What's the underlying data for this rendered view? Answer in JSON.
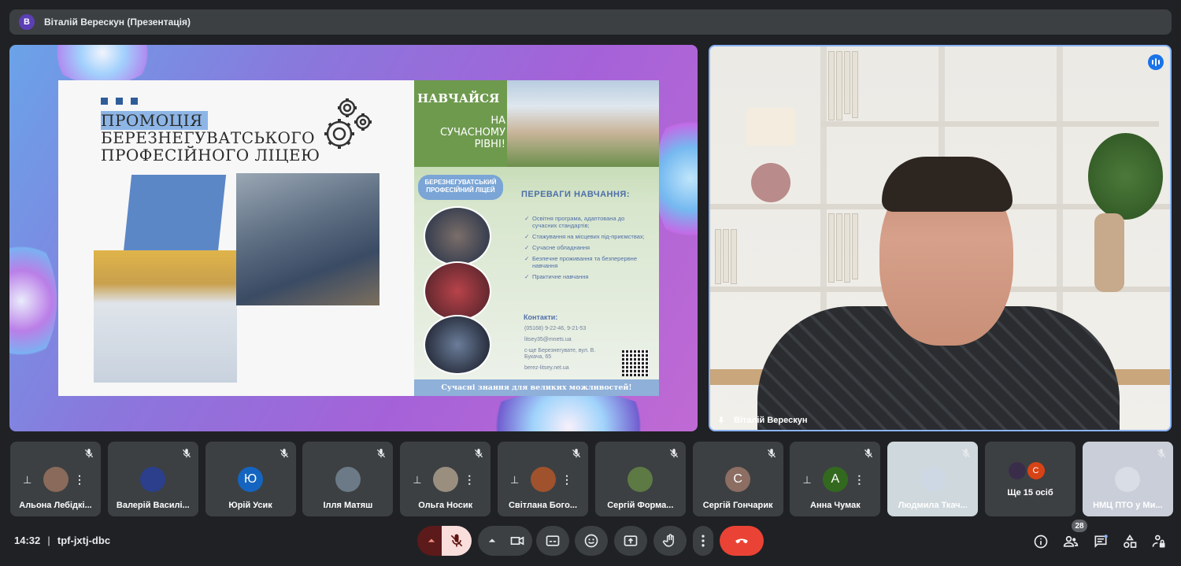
{
  "header": {
    "avatar_letter": "B",
    "title": "Віталій Верескун (Презентація)"
  },
  "presentation": {
    "slide_title_line1": "ПРОМОЦІЯ",
    "slide_title_line2": "БЕРЕЗНЕГУВАТСЬКОГО",
    "slide_title_line3": "ПРОФЕСІЙНОГО ЛІЦЕЮ",
    "navchaisya": "НАВЧАЙСЯ",
    "na_suchasnomu": "НА СУЧАСНОМУ РІВНІ!",
    "pill_text": "БЕРЕЗНЕГУВАТСЬКИЙ ПРОФЕСІЙНИЙ ЛІЦЕЙ",
    "advantages_title": "ПЕРЕВАГИ НАВЧАННЯ:",
    "advantages": [
      "Освітня програма, адаптована до сучасних стандартів;",
      "Стажування на місцевих під-приємствах;",
      "Сучасне обладнання",
      "Безпечне проживання та безперервне навчання",
      "Практичне навчання"
    ],
    "contacts_title": "Контакти:",
    "contacts": [
      "(05168) 9-22-46, 9-21-53",
      "litsey35@mnets.ua",
      "с-ще Березнегувате, вул. В. Букача, 65",
      "berez-litsey.net.ua"
    ],
    "footer_band": "Сучасні знання для великих можливостей!"
  },
  "speaker": {
    "name": "Віталій Верескун"
  },
  "participants": [
    {
      "name": "Альона Лебідкі...",
      "avatar": "",
      "color": "#8a6a5a",
      "pinnable": true
    },
    {
      "name": "Валерій Василі...",
      "avatar": "",
      "color": "#2b3f8c",
      "pinnable": false
    },
    {
      "name": "Юрій Усик",
      "avatar": "Ю",
      "color": "#1565c0",
      "pinnable": false
    },
    {
      "name": "Ілля Матяш",
      "avatar": "",
      "color": "#6b7a86",
      "pinnable": false
    },
    {
      "name": "Ольга Носик",
      "avatar": "",
      "color": "#9a8f7f",
      "pinnable": true
    },
    {
      "name": "Світлана Богo...",
      "avatar": "",
      "color": "#a0522d",
      "pinnable": true
    },
    {
      "name": "Сергій Форма...",
      "avatar": "",
      "color": "#5e7a44",
      "pinnable": false
    },
    {
      "name": "Сергій Гончарик",
      "avatar": "С",
      "color": "#8d6e63",
      "pinnable": false
    },
    {
      "name": "Анна Чумак",
      "avatar": "А",
      "color": "#33691e",
      "pinnable": true
    },
    {
      "name": "Людмила Ткач...",
      "avatar": "",
      "color": "#cdd8e4",
      "pinnable": false
    },
    {
      "name": "Ще 15 осіб",
      "avatar": "С",
      "color": "#d84315",
      "pinnable": false
    },
    {
      "name": "НМЦ ПТО у Ми...",
      "avatar": "",
      "color": "#d9dde6",
      "pinnable": false
    }
  ],
  "meeting": {
    "time": "14:32",
    "code": "tpf-jxtj-dbc",
    "participants_count": "28"
  },
  "colors": {
    "end_call": "#ea4335",
    "mic_off": "#f9dedc",
    "accent": "#8ab4f8"
  }
}
